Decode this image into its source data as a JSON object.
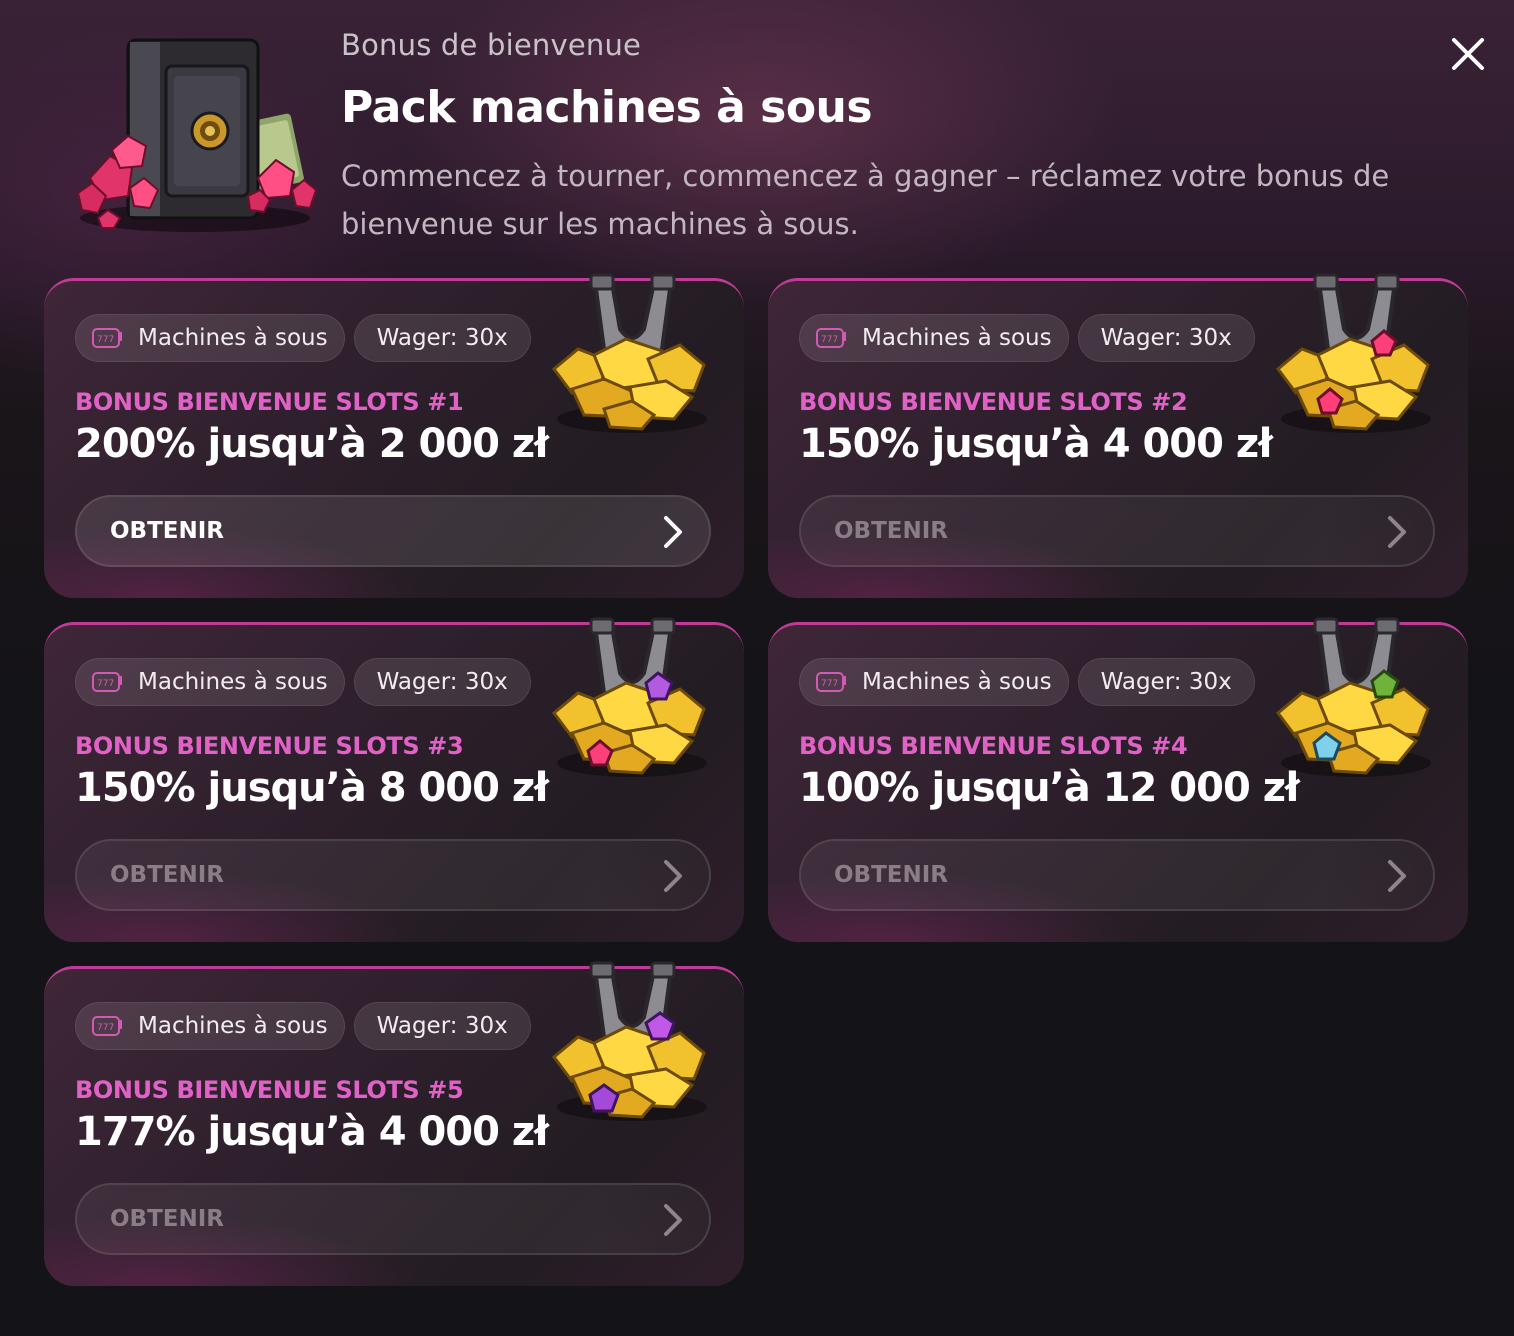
{
  "header": {
    "subtitle": "Bonus de bienvenue",
    "title": "Pack machines à sous",
    "description": "Commencez à tourner, commencez à gagner – réclamez votre bonus de bienvenue sur les machines à sous.",
    "close_icon": "close-icon",
    "image": "safe-with-gems-illustration"
  },
  "colors": {
    "accent": "#e062c6",
    "card_border": "#c03a98",
    "background": "#141318"
  },
  "cards": [
    {
      "tag_category": "Machines à sous",
      "tag_wager": "Wager: 30x",
      "name": "BONUS BIENVENUE SLOTS #1",
      "amount": "200% jusqu’à 2 000 zł",
      "button": "OBTENIR",
      "button_state": "active",
      "gem": "none"
    },
    {
      "tag_category": "Machines à sous",
      "tag_wager": "Wager: 30x",
      "name": "BONUS BIENVENUE SLOTS #2",
      "amount": "150% jusqu’à 4 000 zł",
      "button": "OBTENIR",
      "button_state": "disabled",
      "gem": "red"
    },
    {
      "tag_category": "Machines à sous",
      "tag_wager": "Wager: 30x",
      "name": "BONUS BIENVENUE SLOTS #3",
      "amount": "150% jusqu’à 8 000 zł",
      "button": "OBTENIR",
      "button_state": "disabled",
      "gem": "purple-red"
    },
    {
      "tag_category": "Machines à sous",
      "tag_wager": "Wager: 30x",
      "name": "BONUS BIENVENUE SLOTS #4",
      "amount": "100% jusqu’à 12 000 zł",
      "button": "OBTENIR",
      "button_state": "disabled",
      "gem": "green-blue"
    },
    {
      "tag_category": "Machines à sous",
      "tag_wager": "Wager: 30x",
      "name": "BONUS BIENVENUE SLOTS #5",
      "amount": "177% jusqu’à 4 000 zł",
      "button": "OBTENIR",
      "button_state": "disabled",
      "gem": "purple"
    }
  ]
}
